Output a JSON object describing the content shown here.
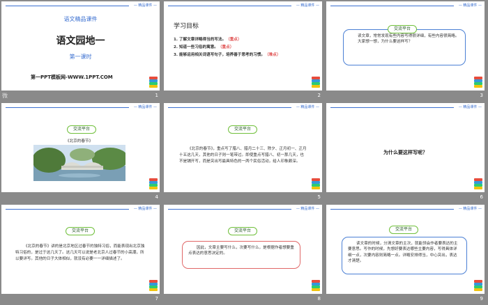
{
  "slides": [
    {
      "num": "1",
      "cat": "语文精品课件",
      "title": "语文园地一",
      "sub": "第一课时",
      "website": "第一PPT模板网-WWW.1PPT.COM",
      "corner": "微"
    },
    {
      "num": "2",
      "heading": "学习目标",
      "goals": [
        {
          "text": "1. 了解文章详略得当的写法。",
          "mark": "（重点）"
        },
        {
          "text": "2. 知道一些习俗的寓意。",
          "mark": "（重点）"
        },
        {
          "text": "3. 能够运用相关词语写句子，培养善于思考的习惯。",
          "mark": "（难点）"
        }
      ]
    },
    {
      "num": "3",
      "pill": "交流平台",
      "p1": "读文章，常常发现有些内容写得很详细，有些内容很简略。",
      "p2": "大家想一想，为什么要这样写？"
    },
    {
      "num": "4",
      "pill": "交流平台",
      "caption": "《北京的春节》"
    },
    {
      "num": "5",
      "pill": "交流平台",
      "text": "《北京的春节》，重点写了腊八、腊月二十三、除夕、正月初一、正月十五这几天，其他的日子则一笔带过。即使重点写腊八、初一那几天，也不是铺开写，而是突出写最具特色的一两个民俗活动，给人印象颇深。"
    },
    {
      "num": "6",
      "question": "为什么要这样写呢？"
    },
    {
      "num": "7",
      "pill": "交流平台",
      "text": "《北京的春节》讲的是北京地区过春节的独特习俗，而能表现出北京独特习俗的，是过于这几天了。这几天可以说是老北京人过春节的小高潮，所以要详写。其他的日子大体相似，就没有必要一一详细描述了。"
    },
    {
      "num": "8",
      "pill": "交流平台",
      "text": "因此，文章主要写什么，次要写什么，是根据作者想要重点表达的意思决定的。"
    },
    {
      "num": "9",
      "pill": "交流平台",
      "text": "读文章的时候，分清文章的主次，就能领会作者要表达的主要意思。写作的时候，先想好要表达哪些主要内容，写得具体详细一点，次要内容则简略一点。详略安排得当，中心突出，表达才清楚。"
    }
  ],
  "header_tag": "— 精品课件 —",
  "colors": {
    "accent": "#3a6fd0",
    "green": "#6fbf3a",
    "red": "#e06666",
    "bg": "#8a8a8a"
  }
}
